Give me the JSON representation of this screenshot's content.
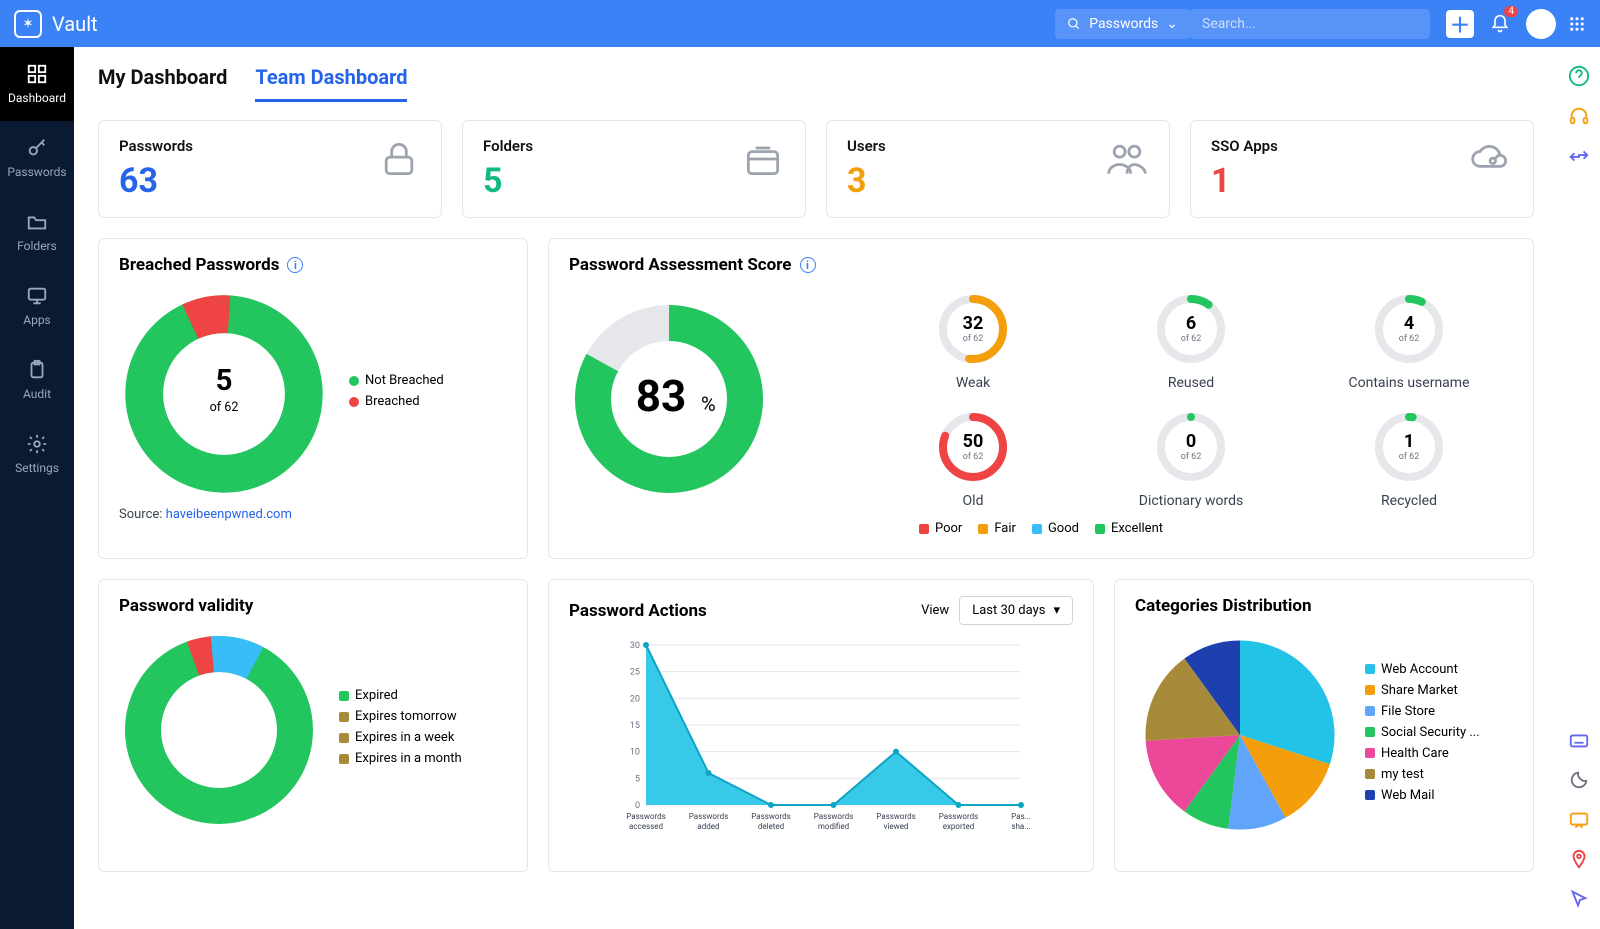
{
  "brand": "Vault",
  "topbar": {
    "dropdown_label": "Passwords",
    "search_placeholder": "Search...",
    "notification_count": "4"
  },
  "sidebar": {
    "items": [
      {
        "label": "Dashboard"
      },
      {
        "label": "Passwords"
      },
      {
        "label": "Folders"
      },
      {
        "label": "Apps"
      },
      {
        "label": "Audit"
      },
      {
        "label": "Settings"
      }
    ]
  },
  "tabs": {
    "my": "My Dashboard",
    "team": "Team Dashboard"
  },
  "stats": {
    "passwords": {
      "label": "Passwords",
      "value": "63",
      "color": "#2563eb"
    },
    "folders": {
      "label": "Folders",
      "value": "5",
      "color": "#10b981"
    },
    "users": {
      "label": "Users",
      "value": "3",
      "color": "#f59e0b"
    },
    "ssoapps": {
      "label": "SSO Apps",
      "value": "1",
      "color": "#ef4444"
    }
  },
  "breached": {
    "title": "Breached Passwords",
    "center_value": "5",
    "center_sub": "of 62",
    "source_prefix": "Source: ",
    "source_link": "haveibeenpwned.com",
    "legend": [
      {
        "label": "Not Breached",
        "color": "#22c55e"
      },
      {
        "label": "Breached",
        "color": "#ef4444"
      }
    ]
  },
  "score": {
    "title": "Password Assessment Score",
    "percent": "83",
    "percent_suffix": "%",
    "rings": [
      {
        "value": "32",
        "sub": "of 62",
        "label": "Weak",
        "color": "#f59e0b",
        "pct": 52
      },
      {
        "value": "6",
        "sub": "of 62",
        "label": "Reused",
        "color": "#22c55e",
        "pct": 10
      },
      {
        "value": "4",
        "sub": "of 62",
        "label": "Contains username",
        "color": "#22c55e",
        "pct": 7
      },
      {
        "value": "50",
        "sub": "of 62",
        "label": "Old",
        "color": "#ef4444",
        "pct": 81
      },
      {
        "value": "0",
        "sub": "of 62",
        "label": "Dictionary words",
        "color": "#22c55e",
        "pct": 0
      },
      {
        "value": "1",
        "sub": "of 62",
        "label": "Recycled",
        "color": "#22c55e",
        "pct": 2
      }
    ],
    "legend": [
      {
        "label": "Poor",
        "color": "#ef4444"
      },
      {
        "label": "Fair",
        "color": "#f59e0b"
      },
      {
        "label": "Good",
        "color": "#38bdf8"
      },
      {
        "label": "Excellent",
        "color": "#22c55e"
      }
    ]
  },
  "validity": {
    "title": "Password validity",
    "legend": [
      {
        "label": "Expired",
        "color": "#22c55e"
      },
      {
        "label": "Expires tomorrow",
        "color": "#a78b3a"
      },
      {
        "label": "Expires in a week",
        "color": "#a78b3a"
      },
      {
        "label": "Expires in a month",
        "color": "#a78b3a"
      }
    ]
  },
  "actions": {
    "title": "Password Actions",
    "view_label": "View",
    "range": "Last 30 days"
  },
  "categories": {
    "title": "Categories Distribution",
    "legend": [
      {
        "label": "Web Account",
        "color": "#22c3e6"
      },
      {
        "label": "Share Market",
        "color": "#f59e0b"
      },
      {
        "label": "File Store",
        "color": "#60a5fa"
      },
      {
        "label": "Social Security ...",
        "color": "#22c55e"
      },
      {
        "label": "Health Care",
        "color": "#ec4899"
      },
      {
        "label": "my test",
        "color": "#a78b3a"
      },
      {
        "label": "Web Mail",
        "color": "#1e40af"
      }
    ]
  },
  "chart_data": [
    {
      "type": "pie",
      "title": "Breached Passwords",
      "series": [
        {
          "name": "Not Breached",
          "value": 57
        },
        {
          "name": "Breached",
          "value": 5
        }
      ],
      "total_label": "of 62"
    },
    {
      "type": "pie",
      "title": "Password Assessment Score",
      "percent": 83,
      "legend": [
        "Poor",
        "Fair",
        "Good",
        "Excellent"
      ]
    },
    {
      "type": "pie",
      "title": "Password validity",
      "series": [
        {
          "name": "Expired",
          "value": 85
        },
        {
          "name": "Expires tomorrow",
          "value": 4
        },
        {
          "name": "Expires in a week",
          "value": 3
        },
        {
          "name": "Expires in a month",
          "value": 8
        }
      ]
    },
    {
      "type": "area",
      "title": "Password Actions",
      "ylabel": "",
      "ylim": [
        0,
        30
      ],
      "yticks": [
        0,
        5,
        10,
        15,
        20,
        25,
        30
      ],
      "categories": [
        "Passwords accessed",
        "Passwords added",
        "Passwords deleted",
        "Passwords modified",
        "Passwords viewed",
        "Passwords exported",
        "Pas... sha... upd..."
      ],
      "values": [
        30,
        6,
        0,
        0,
        10,
        0,
        0
      ]
    },
    {
      "type": "pie",
      "title": "Categories Distribution",
      "series": [
        {
          "name": "Web Account",
          "value": 30
        },
        {
          "name": "Share Market",
          "value": 12
        },
        {
          "name": "Web Mail",
          "value": 10
        },
        {
          "name": "File Store",
          "value": 8
        },
        {
          "name": "Social Security ...",
          "value": 14
        },
        {
          "name": "Health Care",
          "value": 16
        },
        {
          "name": "my test",
          "value": 10
        }
      ]
    }
  ]
}
